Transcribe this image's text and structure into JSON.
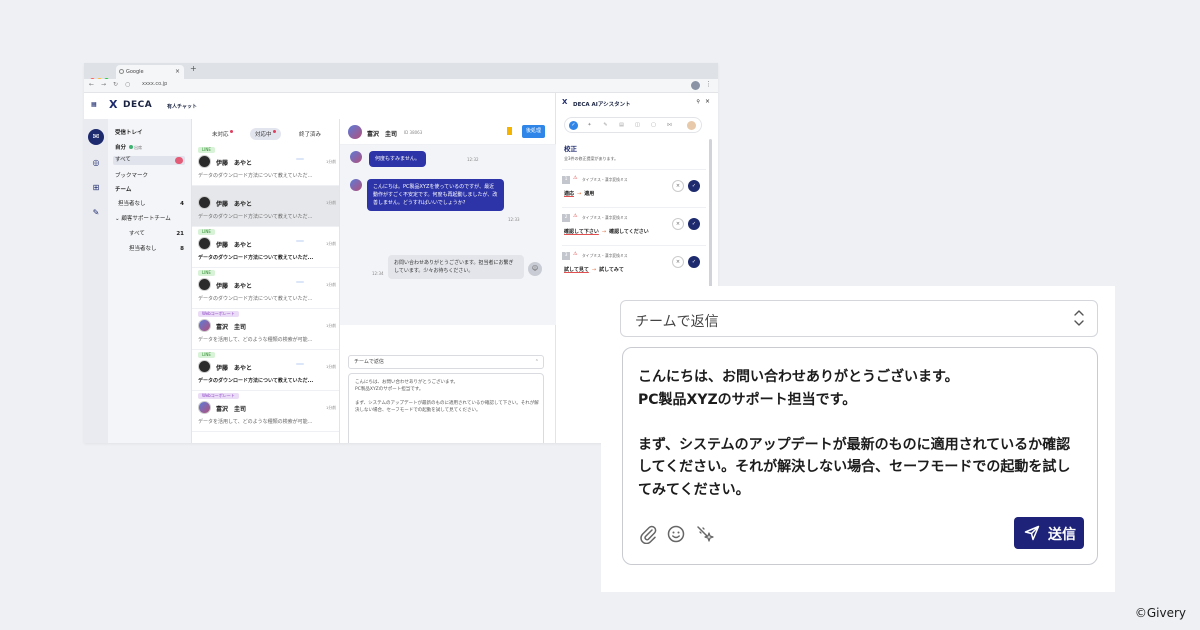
{
  "browser": {
    "tab_title": "Google",
    "tab_close": "×",
    "new_tab": "+",
    "url": "xxxx.co.jp",
    "dot_colors": [
      "#ff5f57",
      "#febc2e",
      "#28c840"
    ]
  },
  "app": {
    "logo": "DECA",
    "logo_sub": "有人チャット"
  },
  "nav": {
    "inbox": "受信トレイ",
    "mine": "自分",
    "mine_status": "出席",
    "all": "すべて",
    "bookmark": "ブックマーク",
    "team": "チーム",
    "unassigned": "担当者なし",
    "unassigned_count": "4",
    "support_team": "顧客サポートチーム",
    "team_all": "すべて",
    "team_all_count": "21",
    "team_unassigned": "担当者なし",
    "team_unassigned_count": "8"
  },
  "conv_tabs": [
    "未対応",
    "対応中",
    "終了済み"
  ],
  "conversations": [
    {
      "tag": "LINE",
      "name": "伊藤　あやと",
      "badge": "",
      "time": "1分前",
      "preview": "データのダウンロード方法について教えていただ..."
    },
    {
      "tag": "",
      "name": "伊藤　あやと",
      "badge": "",
      "time": "1分前",
      "preview": "データのダウンロード方法について教えていただ..."
    },
    {
      "tag": "LINE",
      "name": "伊藤　あやと",
      "badge": "",
      "time": "1分前",
      "preview": "データのダウンロード方法について教えていただ..."
    },
    {
      "tag": "LINE",
      "name": "伊藤　あやと",
      "badge": "",
      "time": "1分前",
      "preview": "データのダウンロード方法について教えていただ..."
    },
    {
      "tag": "Webコーポレート",
      "name": "富沢　圭司",
      "badge": "",
      "time": "1分前",
      "preview": "データを活用して、どのような種類の検索が可能..."
    },
    {
      "tag": "LINE",
      "name": "伊藤　あやと",
      "badge": "",
      "time": "1分前",
      "preview": "データのダウンロード方法について教えていただ..."
    },
    {
      "tag": "Webコーポレート",
      "name": "富沢　圭司",
      "badge": "",
      "time": "1分前",
      "preview": "データを活用して、どのような種類の検索が可能..."
    }
  ],
  "chat": {
    "name": "富沢　圭司",
    "id": "ID 38063",
    "done_button": "後処理",
    "msg1": "何度もすみません。",
    "msg1_time": "12:32",
    "msg2": "こんにちは。PC製品XYZを使っているのですが、最近動作がすごく不安定です。何度も再起動しましたが、改善しません。どうすればいいでしょうか?",
    "msg2_time": "12:33",
    "msg3": "お問い合わせありがとうございます。担当者にお繋ぎしています。少々お待ちください。",
    "msg3_time": "12:34",
    "reply_mode": "チームで返信",
    "draft": "こんにちは、お問い合わせありがとうございます。\nPC製品XYZのサポート担当です。\n\nまず、システムのアップデートが最新のものに適用されているか確認して下さい。それが解決しない場合、セーフモードでの起動を試して見てください。",
    "send": "送信"
  },
  "ai": {
    "title": "DECA AIアシスタント",
    "section": "校正",
    "note": "全3件の修正提案があります。",
    "suggestions": [
      {
        "num": "1",
        "type": "タイプミス・漢字変換ミス",
        "old": "適応",
        "new": "適用"
      },
      {
        "num": "2",
        "type": "タイプミス・漢字変換ミス",
        "old": "確認して下さい",
        "new": "確認してください"
      },
      {
        "num": "3",
        "type": "タイプミス・漢字変換ミス",
        "old": "試して見て",
        "new": "試してみて"
      }
    ]
  },
  "zoom": {
    "reply_mode": "チームで返信",
    "message": "こんにちは、お問い合わせありがとうございます。\nPC製品XYZのサポート担当です。\n\nまず、システムのアップデートが最新のものに適用されているか確認\nしてください。それが解決しない場合、セーフモードでの起動を試し\nてみてください。",
    "send": "送信"
  },
  "copyright": "©Givery",
  "colors": {
    "brand_navy": "#1e2379",
    "user_bubble": "#2d34a8",
    "accent_blue": "#2f86e8",
    "page_bg": "#eef0f4"
  }
}
